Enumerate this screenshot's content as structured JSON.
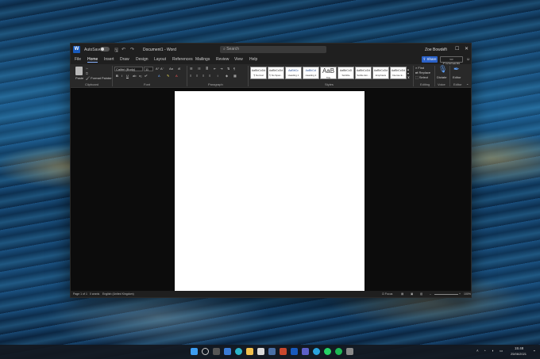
{
  "window": {
    "app_icon": "W",
    "autosave_label": "AutoSave",
    "autosave_state": "Off",
    "doc_title": "Document1 - Word",
    "search_placeholder": "Search",
    "user_name": "Zoe Bowden",
    "controls": {
      "minimize": "–",
      "maximize": "☐",
      "close": "✕"
    }
  },
  "tabs": [
    "File",
    "Home",
    "Insert",
    "Draw",
    "Design",
    "Layout",
    "References",
    "Mailings",
    "Review",
    "View",
    "Help"
  ],
  "active_tab": "Home",
  "share_label": "Share",
  "comments_label": "Comments",
  "ribbon": {
    "clipboard": {
      "paste": "Paste",
      "format_painter": "Format Painter",
      "group": "Clipboard"
    },
    "font": {
      "family": "Calibri (Body)",
      "size": "11",
      "bold": "B",
      "italic": "I",
      "underline": "U",
      "group": "Font"
    },
    "paragraph": {
      "group": "Paragraph"
    },
    "styles": {
      "group": "Styles",
      "items": [
        {
          "sample": "AaBbCcDd",
          "name": "¶ Normal"
        },
        {
          "sample": "AaBbCcDd",
          "name": "¶ No Spac..."
        },
        {
          "sample": "AaBbCc",
          "name": "Heading 1"
        },
        {
          "sample": "AaBbCcI",
          "name": "Heading 2"
        },
        {
          "sample": "AaB",
          "name": "Title"
        },
        {
          "sample": "AaBbCcD",
          "name": "Subtitle"
        },
        {
          "sample": "AaBbCcDd",
          "name": "Subtle Em..."
        },
        {
          "sample": "AaBbCcDd",
          "name": "Emphasis"
        },
        {
          "sample": "AaBbCcDd",
          "name": "Intense E..."
        }
      ]
    },
    "editing": {
      "find": "Find",
      "replace": "Replace",
      "select": "Select",
      "group": "Editing"
    },
    "voice": {
      "dictate": "Dictate",
      "group": "Voice"
    },
    "editor": {
      "label": "Editor",
      "group": "Editor"
    }
  },
  "status": {
    "page": "Page 1 of 1",
    "words": "0 words",
    "language": "English (United Kingdom)",
    "focus": "Focus",
    "zoom": "100%"
  },
  "taskbar": {
    "time": "15:48",
    "date": "25/06/2021"
  },
  "colors": {
    "accent": "#2b62c9",
    "word_blue": "#185abd"
  }
}
